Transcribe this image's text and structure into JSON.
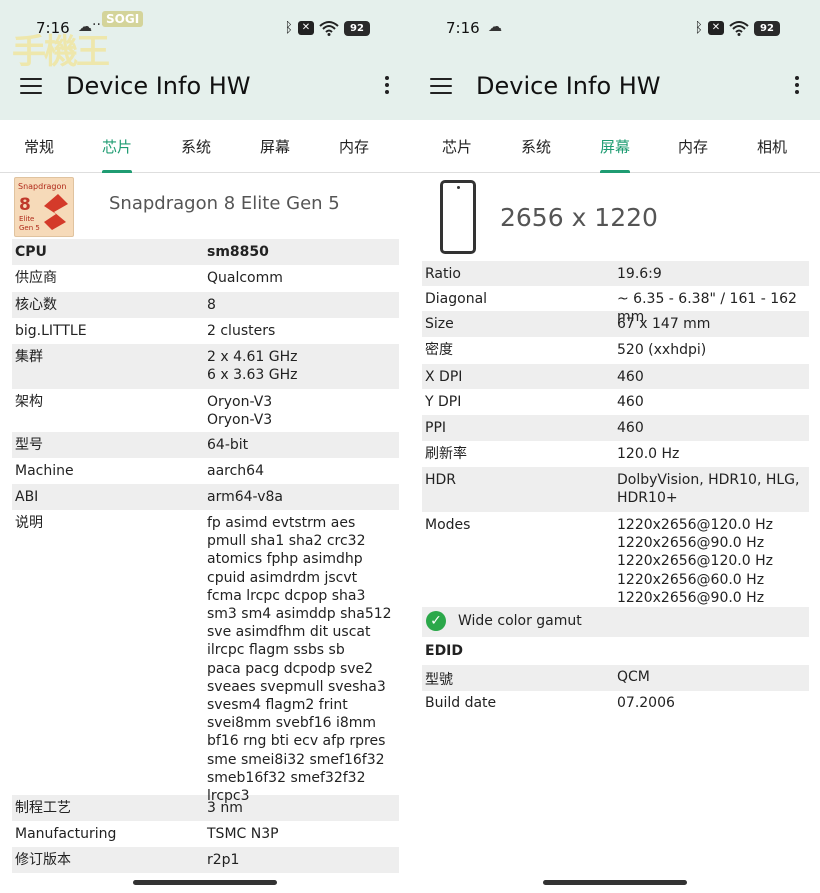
{
  "app": {
    "title": "Device Info HW"
  },
  "watermark": {
    "badge": "SOGI",
    "text": "手機王"
  },
  "left": {
    "status": {
      "time": "7:16",
      "dots": "···",
      "battery": "92"
    },
    "tabs": [
      {
        "label": "常规",
        "active": false
      },
      {
        "label": "芯片",
        "active": true
      },
      {
        "label": "系统",
        "active": false
      },
      {
        "label": "屏幕",
        "active": false
      },
      {
        "label": "内存",
        "active": false
      }
    ],
    "chip": {
      "logo_brand": "Snapdragon",
      "logo_number": "8",
      "logo_sub_1": "Elite",
      "logo_sub_2": "Gen 5",
      "name": "Snapdragon 8 Elite Gen 5"
    },
    "rows": [
      {
        "key": "CPU",
        "value": "sm8850",
        "bold": true
      },
      {
        "key": "供应商",
        "value": "Qualcomm"
      },
      {
        "key": "核心数",
        "value": "8"
      },
      {
        "key": "big.LITTLE",
        "value": "2 clusters"
      },
      {
        "key": "集群",
        "value": "2 x 4.61 GHz\n6 x 3.63 GHz"
      },
      {
        "key": "架构",
        "value": "Oryon-V3\nOryon-V3"
      },
      {
        "key": "型号",
        "value": "64-bit"
      },
      {
        "key": "Machine",
        "value": "aarch64"
      },
      {
        "key": "ABI",
        "value": "arm64-v8a"
      },
      {
        "key": "说明",
        "value": "fp asimd evtstrm aes\npmull sha1 sha2 crc32\natomics fphp asimdhp\ncpuid asimdrdm jscvt\nfcma lrcpc dcpop sha3\nsm3 sm4 asimddp sha512\nsve asimdfhm dit uscat\nilrcpc flagm ssbs sb\npaca pacg dcpodp sve2\nsveaes svepmull svesha3\nsvesm4 flagm2 frint\nsvei8mm svebf16 i8mm\nbf16 rng bti ecv afp rpres\nsme smei8i32 smef16f32\nsmeb16f32 smef32f32\nlrcpc3"
      },
      {
        "key": "制程工艺",
        "value": "3 nm"
      },
      {
        "key": "Manufacturing",
        "value": "TSMC N3P"
      },
      {
        "key": "修订版本",
        "value": "r2p1"
      }
    ]
  },
  "right": {
    "status": {
      "time": "7:16",
      "battery": "92"
    },
    "tabs": [
      {
        "label": "芯片",
        "active": false
      },
      {
        "label": "系统",
        "active": false
      },
      {
        "label": "屏幕",
        "active": true
      },
      {
        "label": "内存",
        "active": false
      },
      {
        "label": "相机",
        "active": false
      }
    ],
    "resolution": "2656 x 1220",
    "rows": [
      {
        "key": "Ratio",
        "value": "19.6:9"
      },
      {
        "key": "Diagonal",
        "value": "~ 6.35 - 6.38\" / 161 - 162 mm"
      },
      {
        "key": "Size",
        "value": "67 x 147 mm"
      },
      {
        "key": "密度",
        "value": "520 (xxhdpi)"
      },
      {
        "key": "X DPI",
        "value": "460"
      },
      {
        "key": "Y DPI",
        "value": "460"
      },
      {
        "key": "PPI",
        "value": "460"
      },
      {
        "key": "刷新率",
        "value": "120.0 Hz"
      },
      {
        "key": "HDR",
        "value": "DolbyVision, HDR10, HLG,\nHDR10+"
      },
      {
        "key": "Modes",
        "value": "1220x2656@120.0 Hz\n1220x2656@90.0 Hz\n1220x2656@120.0 Hz\n1220x2656@60.0 Hz\n1220x2656@90.0 Hz"
      }
    ],
    "wide_color": "Wide color gamut",
    "edid": {
      "section_title": "EDID",
      "rows": [
        {
          "key": "型號",
          "value": "QCM"
        },
        {
          "key": "Build date",
          "value": "07.2006"
        }
      ]
    }
  }
}
